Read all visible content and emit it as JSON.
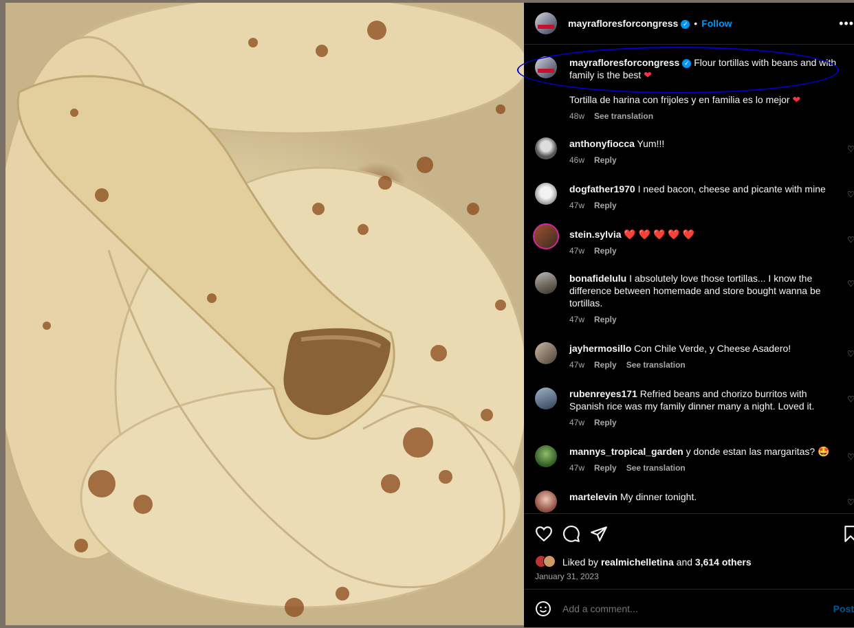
{
  "post": {
    "author": "mayrafloresforcongress",
    "follow_label": "Follow",
    "dot": "•",
    "more_label": "•••",
    "caption": "Flour tortillas with beans and with family is the best",
    "caption_es": "Tortilla de harina con frijoles y en familia es lo mejor",
    "caption_time": "48w",
    "see_translation": "See translation",
    "liked_by_prefix": "Liked by",
    "liked_by_user": "realmichelletina",
    "liked_by_and": "and",
    "liked_by_others": "3,614 others",
    "date": "January 31, 2023",
    "add_comment_placeholder": "Add a comment...",
    "post_label": "Post"
  },
  "reply_label": "Reply",
  "comments": [
    {
      "user": "anthonyfiocca",
      "text": "Yum!!!",
      "time": "46w",
      "translate": ""
    },
    {
      "user": "dogfather1970",
      "text": "I need bacon, cheese and picante with mine",
      "time": "47w",
      "translate": ""
    },
    {
      "user": "stein.sylvia",
      "text": "❤️ ❤️ ❤️ ❤️ ❤️",
      "time": "47w",
      "translate": ""
    },
    {
      "user": "bonafidelulu",
      "text": "I absolutely love those tortillas... I know the difference between homemade and store bought wanna be tortillas.",
      "time": "47w",
      "translate": ""
    },
    {
      "user": "jayhermosillo",
      "text": "Con Chile Verde, y Cheese Asadero!",
      "time": "47w",
      "translate": "See translation"
    },
    {
      "user": "rubenreyes171",
      "text": "Refried beans and chorizo burritos with Spanish rice was my family dinner many a night. Loved it.",
      "time": "47w",
      "translate": ""
    },
    {
      "user": "mannys_tropical_garden",
      "text": "y donde estan las margaritas? 🤩",
      "time": "47w",
      "translate": "See translation"
    },
    {
      "user": "martelevin",
      "text": "My dinner tonight.",
      "time": "",
      "translate": ""
    }
  ],
  "icons": {
    "verified": "verified-badge-icon",
    "like": "heart-icon",
    "comment": "comment-bubble-icon",
    "share": "paper-plane-icon",
    "save": "bookmark-icon",
    "emoji": "emoji-smile-icon"
  },
  "colors": {
    "accent": "#0095f6",
    "heart": "#ff3040",
    "annotation": "#0000cc"
  }
}
